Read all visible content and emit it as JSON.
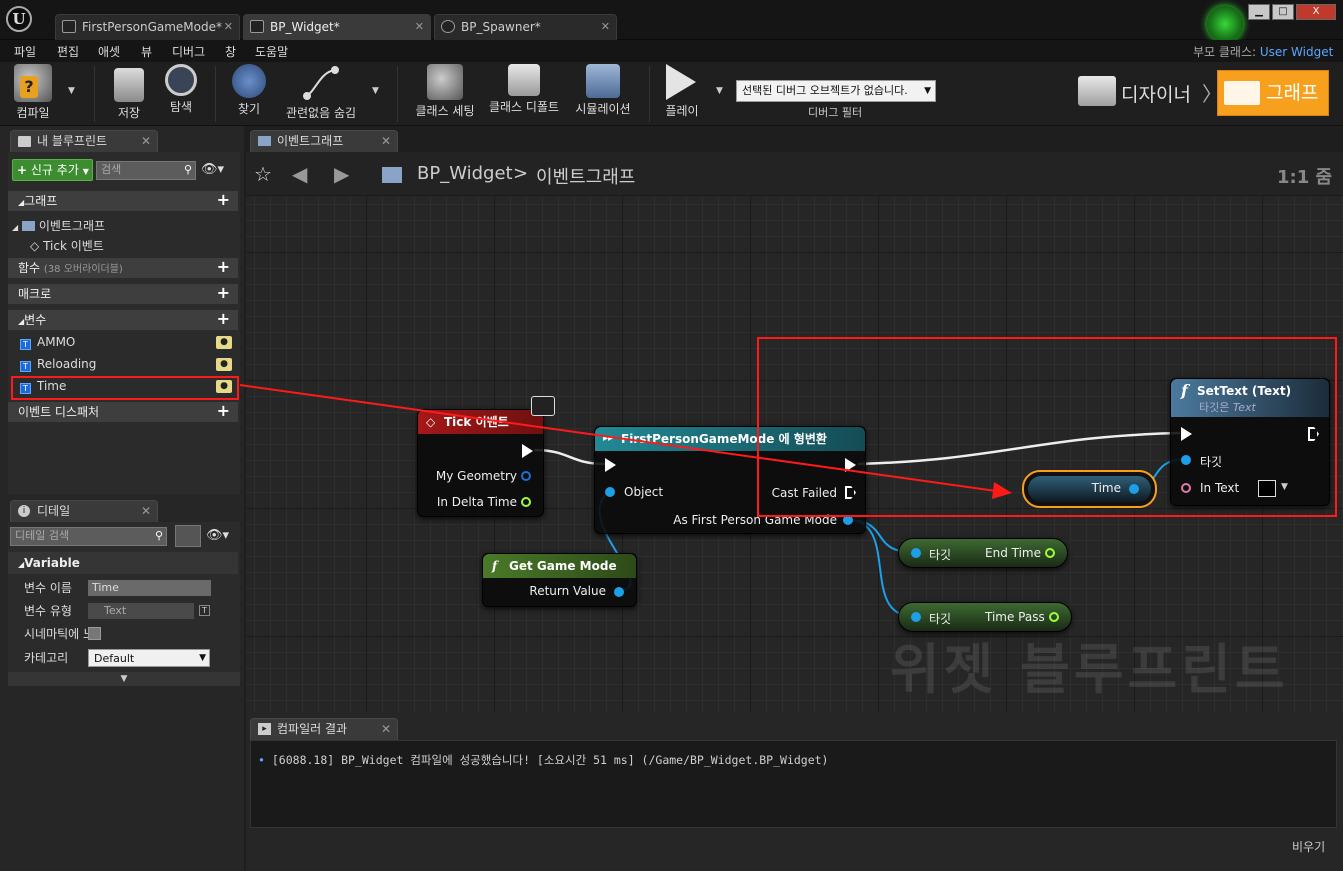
{
  "tabs": [
    {
      "label": "FirstPersonGameMode*",
      "active": false
    },
    {
      "label": "BP_Widget*",
      "active": true
    },
    {
      "label": "BP_Spawner*",
      "active": false
    }
  ],
  "window_controls": {
    "minimize": "▁",
    "maximize": "□",
    "close": "X"
  },
  "menu": [
    "파일",
    "편집",
    "애셋",
    "뷰",
    "디버그",
    "창",
    "도움말"
  ],
  "parent_class": {
    "label": "부모 클래스:",
    "value": "User Widget"
  },
  "toolbar": {
    "compile": "컴파일",
    "save": "저장",
    "browse": "탐색",
    "find": "찾기",
    "hide_unrelated": "관련없음 숨김",
    "class_settings": "클래스 세팅",
    "class_defaults": "클래스 디폴트",
    "simulation": "시뮬레이션",
    "play": "플레이",
    "debug_dropdown": "선택된 디버그 오브젝트가 없습니다.",
    "debug_filter": "디버그 필터",
    "designer": "디자이너",
    "graph": "그래프"
  },
  "my_blueprint": {
    "tab": "내 블루프린트",
    "add_new": "신규 추가",
    "search_placeholder": "검색",
    "graphs": "그래프",
    "event_graph": "이벤트그래프",
    "tick_event": "Tick 이벤트",
    "functions": "함수",
    "functions_note": "(38 오버라이더블)",
    "macros": "매크로",
    "variables": "변수",
    "vars": [
      "AMMO",
      "Reloading",
      "Time"
    ],
    "event_dispatchers": "이벤트 디스패처"
  },
  "details": {
    "tab": "디테일",
    "search_placeholder": "디테일 검색",
    "section": "Variable",
    "rows": [
      {
        "label": "변수 이름",
        "value": "Time"
      },
      {
        "label": "변수 유형",
        "value": "Text"
      },
      {
        "label": "시네마틱에 노",
        "value": ""
      },
      {
        "label": "카테고리",
        "value": "Default"
      }
    ]
  },
  "graph": {
    "tab": "이벤트그래프",
    "breadcrumb_bp": "BP_Widget",
    "breadcrumb_sep": ">",
    "breadcrumb_graph": "이벤트그래프",
    "zoom": "1:1 줌",
    "watermark": "위젯 블루프린트",
    "nodes": {
      "tick": {
        "title": "Tick 이벤트",
        "pins": [
          "My Geometry",
          "In Delta Time"
        ]
      },
      "cast": {
        "title": "FirstPersonGameMode 에 형변환",
        "pins": [
          "Object",
          "Cast Failed",
          "As First Person Game Mode"
        ]
      },
      "get_game_mode": {
        "title": "Get Game Mode",
        "pins": [
          "Return Value"
        ]
      },
      "end_time": {
        "target": "타깃",
        "label": "End Time"
      },
      "time_pass": {
        "target": "타깃",
        "label": "Time Pass"
      },
      "time_var": {
        "label": "Time"
      },
      "settext": {
        "title": "SetText (Text)",
        "subtitle_prefix": "타깃은 ",
        "subtitle_em": "Text",
        "pins": [
          "타깃",
          "In Text"
        ]
      }
    }
  },
  "compiler": {
    "tab": "컴파일러 결과",
    "log": "[6088.18] BP_Widget 컴파일에 성공했습니다! [소요시간 51 ms] (/Game/BP_Widget.BP_Widget)",
    "clear": "비우기"
  },
  "colors": {
    "accent": "#f7a01e",
    "highlight": "#ff1a1a",
    "link": "#5aa7ff",
    "tick_header": "#8c1414",
    "cast_header": "#1e6a72",
    "func_header": "#3b5f1f"
  }
}
